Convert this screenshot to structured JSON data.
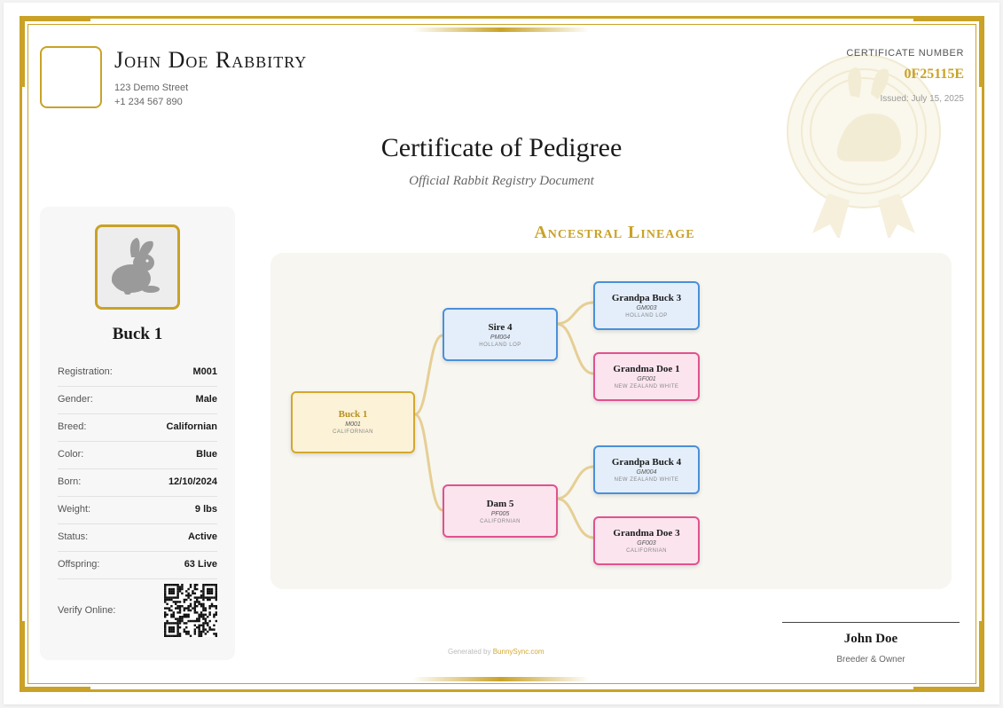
{
  "header": {
    "rabbitry_name": "John Doe Rabbitry",
    "address": "123 Demo Street",
    "phone": "+1 234 567 890",
    "certificate_label": "CERTIFICATE NUMBER",
    "certificate_number": "0F25115E",
    "issued": "Issued: July 15, 2025"
  },
  "title": "Certificate of Pedigree",
  "subtitle": "Official Rabbit Registry Document",
  "rabbit": {
    "name": "Buck 1",
    "photo_icon": "rabbit-icon",
    "details": [
      {
        "label": "Registration:",
        "value": "M001"
      },
      {
        "label": "Gender:",
        "value": "Male"
      },
      {
        "label": "Breed:",
        "value": "Californian"
      },
      {
        "label": "Color:",
        "value": "Blue"
      },
      {
        "label": "Born:",
        "value": "12/10/2024"
      },
      {
        "label": "Weight:",
        "value": "9 lbs"
      },
      {
        "label": "Status:",
        "value": "Active"
      },
      {
        "label": "Offspring:",
        "value": "63 Live"
      }
    ],
    "verify_label": "Verify Online:"
  },
  "lineage": {
    "title": "Ancestral Lineage",
    "subject": {
      "name": "Buck 1",
      "reg": "M001",
      "breed": "CALIFORNIAN"
    },
    "sire": {
      "name": "Sire 4",
      "reg": "PM004",
      "breed": "HOLLAND LOP"
    },
    "dam": {
      "name": "Dam 5",
      "reg": "PF005",
      "breed": "CALIFORNIAN"
    },
    "sire_sire": {
      "name": "Grandpa Buck 3",
      "reg": "GM003",
      "breed": "HOLLAND LOP"
    },
    "sire_dam": {
      "name": "Grandma Doe 1",
      "reg": "GF001",
      "breed": "NEW ZEALAND WHITE"
    },
    "dam_sire": {
      "name": "Grandpa Buck 4",
      "reg": "GM004",
      "breed": "NEW ZEALAND WHITE"
    },
    "dam_dam": {
      "name": "Grandma Doe 3",
      "reg": "GF003",
      "breed": "CALIFORNIAN"
    }
  },
  "footer": {
    "generated_prefix": "Generated by",
    "generated_brand": "BunnySync.com",
    "signature_name": "John Doe",
    "signature_role": "Breeder & Owner"
  },
  "colors": {
    "gold": "#c9a227",
    "male": "#4a90d9",
    "female": "#e0528f"
  }
}
